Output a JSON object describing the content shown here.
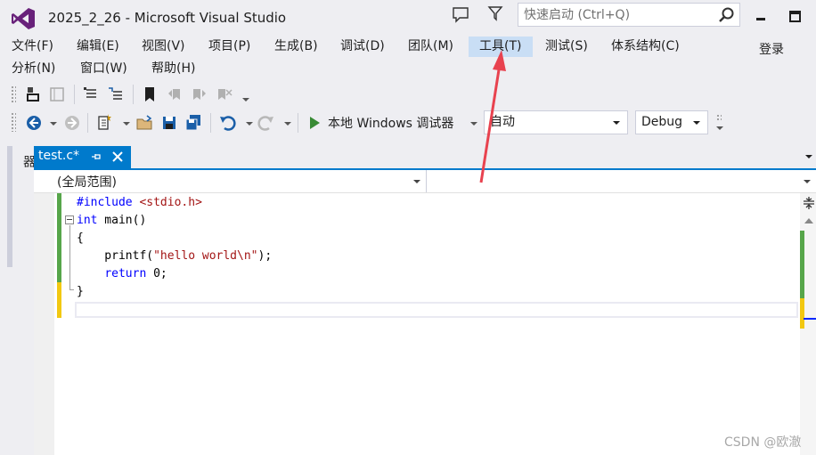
{
  "window": {
    "title": "2025_2_26 - Microsoft Visual Studio",
    "quick_launch_placeholder": "快速启动 (Ctrl+Q)",
    "icons": [
      "vs-logo-icon",
      "feedback-icon",
      "filter-icon",
      "search-icon",
      "minimize-icon",
      "maximize-icon"
    ]
  },
  "menu": {
    "row1": [
      {
        "label": "文件(F)"
      },
      {
        "label": "编辑(E)"
      },
      {
        "label": "视图(V)"
      },
      {
        "label": "项目(P)"
      },
      {
        "label": "生成(B)"
      },
      {
        "label": "调试(D)"
      },
      {
        "label": "团队(M)"
      },
      {
        "label": "工具(T)",
        "highlighted": true
      },
      {
        "label": "测试(S)"
      },
      {
        "label": "体系结构(C)"
      }
    ],
    "row2": [
      {
        "label": "分析(N)"
      },
      {
        "label": "窗口(W)"
      },
      {
        "label": "帮助(H)"
      }
    ],
    "login": "登录",
    "highlight_color": "#c9def5"
  },
  "toolbar": {
    "run_label": "本地 Windows 调试器",
    "platform_combo": "自动",
    "config_combo": "Debug"
  },
  "sidebar": {
    "label": "解决方案资源管理器"
  },
  "document_tab": {
    "label": "test.c*",
    "accent": "#007acc"
  },
  "navigation": {
    "scope": "(全局范围)",
    "member": ""
  },
  "editor": {
    "lines": [
      "#include <stdio.h>",
      "int main()",
      "{",
      "    printf(\"hello world\\n\");",
      "    return 0;",
      "}"
    ]
  },
  "watermark": "CSDN @欧澈"
}
